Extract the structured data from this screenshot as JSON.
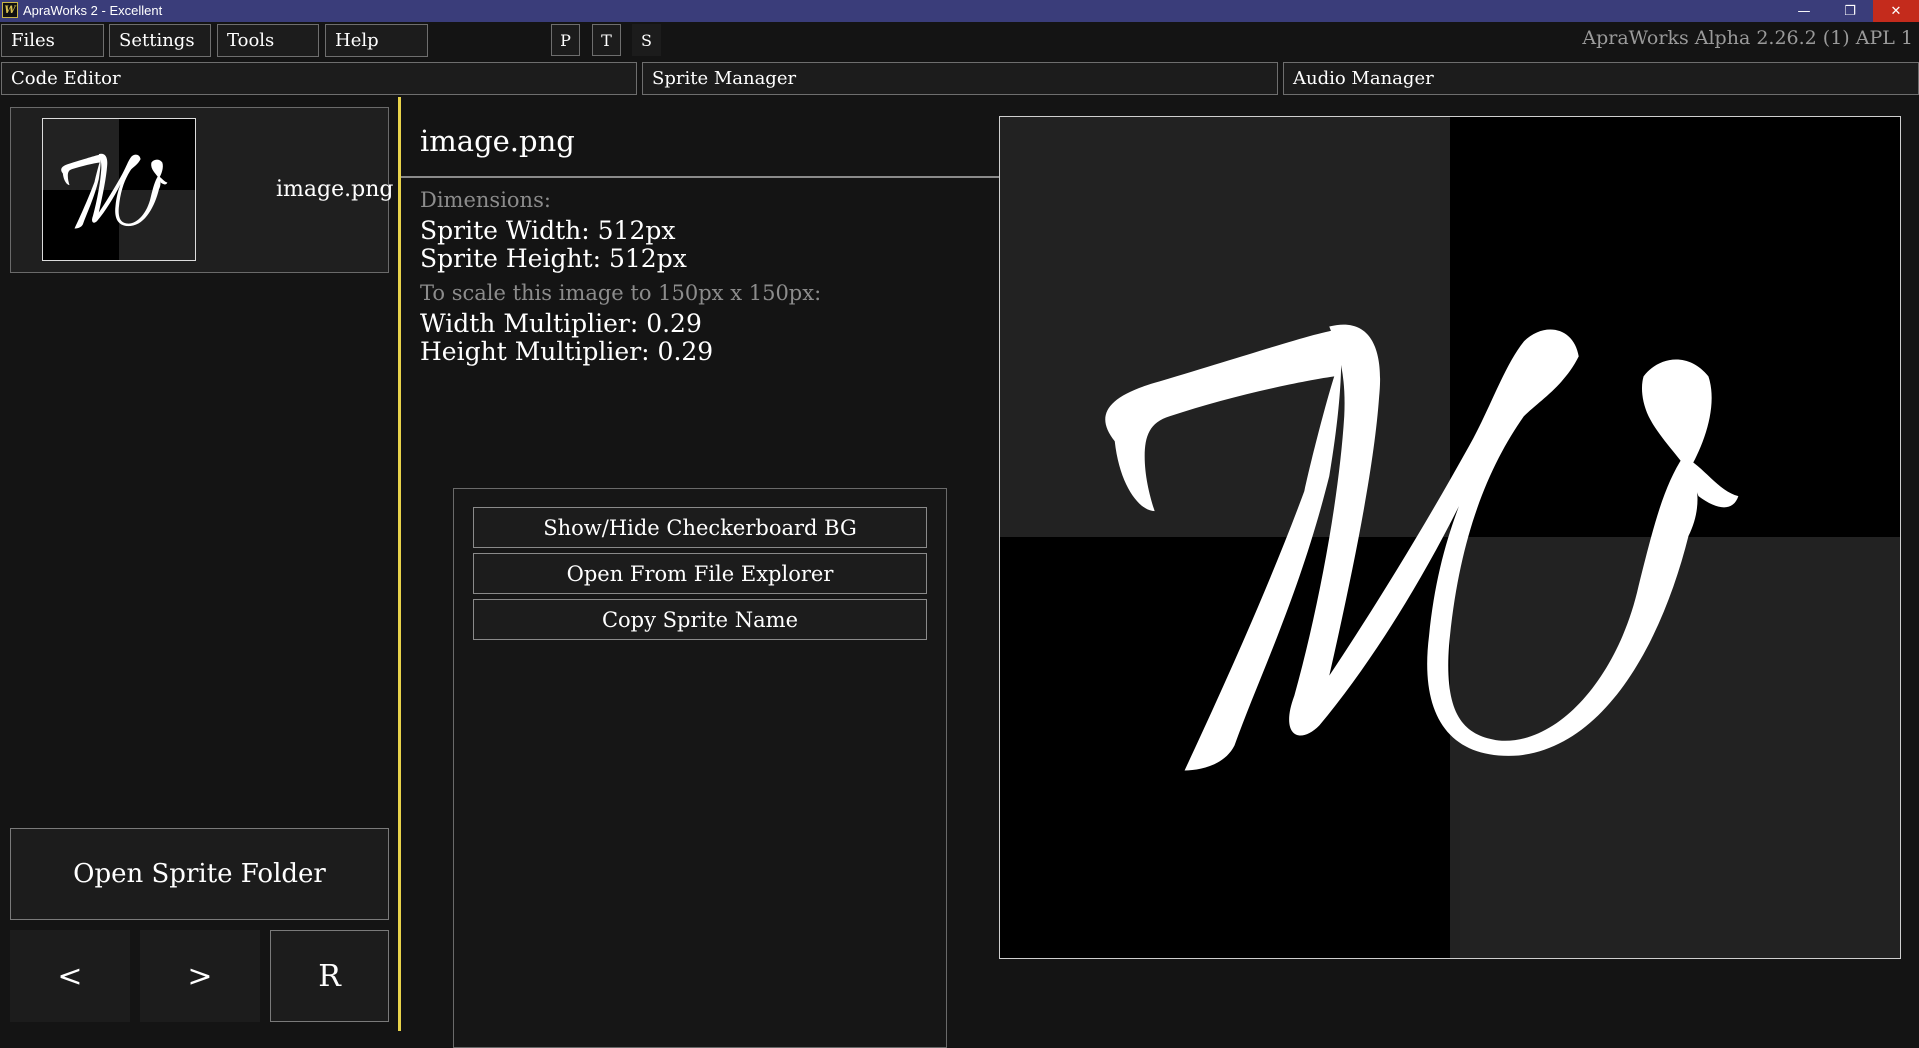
{
  "window": {
    "title": "ApraWorks 2 - Excellent",
    "icon_glyph": "W",
    "minimize_icon": "—",
    "maximize_icon": "❐",
    "close_icon": "✕"
  },
  "menu": {
    "items": [
      {
        "label": "Files"
      },
      {
        "label": "Settings"
      },
      {
        "label": "Tools"
      },
      {
        "label": "Help"
      }
    ],
    "toggles": [
      {
        "label": "P"
      },
      {
        "label": "T"
      },
      {
        "label": "S"
      }
    ],
    "version": "ApraWorks Alpha 2.26.2 (1) APL 1"
  },
  "tabs": [
    {
      "label": "Code Editor"
    },
    {
      "label": "Sprite Manager"
    },
    {
      "label": "Audio Manager"
    }
  ],
  "sprite_list": {
    "items": [
      {
        "name": "image.png"
      }
    ],
    "open_folder_label": "Open Sprite Folder",
    "prev_label": "<",
    "next_label": ">",
    "refresh_label": "R"
  },
  "details": {
    "name": "image.png",
    "dimensions_heading": "Dimensions:",
    "width_text": "Sprite Width: 512px",
    "height_text": "Sprite Height: 512px",
    "scale_heading": "To scale this image to 150px x 150px:",
    "width_multiplier_text": "Width Multiplier: 0.29",
    "height_multiplier_text": "Height Multiplier: 0.29"
  },
  "actions": [
    {
      "label": "Show/Hide Checkerboard BG"
    },
    {
      "label": "Open From File Explorer"
    },
    {
      "label": "Copy Sprite Name"
    }
  ],
  "colors": {
    "background": "#141414",
    "accent_divider": "#e8d34a",
    "title_bar": "#3a3d7a",
    "close_button": "#c42b1c",
    "checker_light": "#222222",
    "checker_dark": "#000000"
  }
}
